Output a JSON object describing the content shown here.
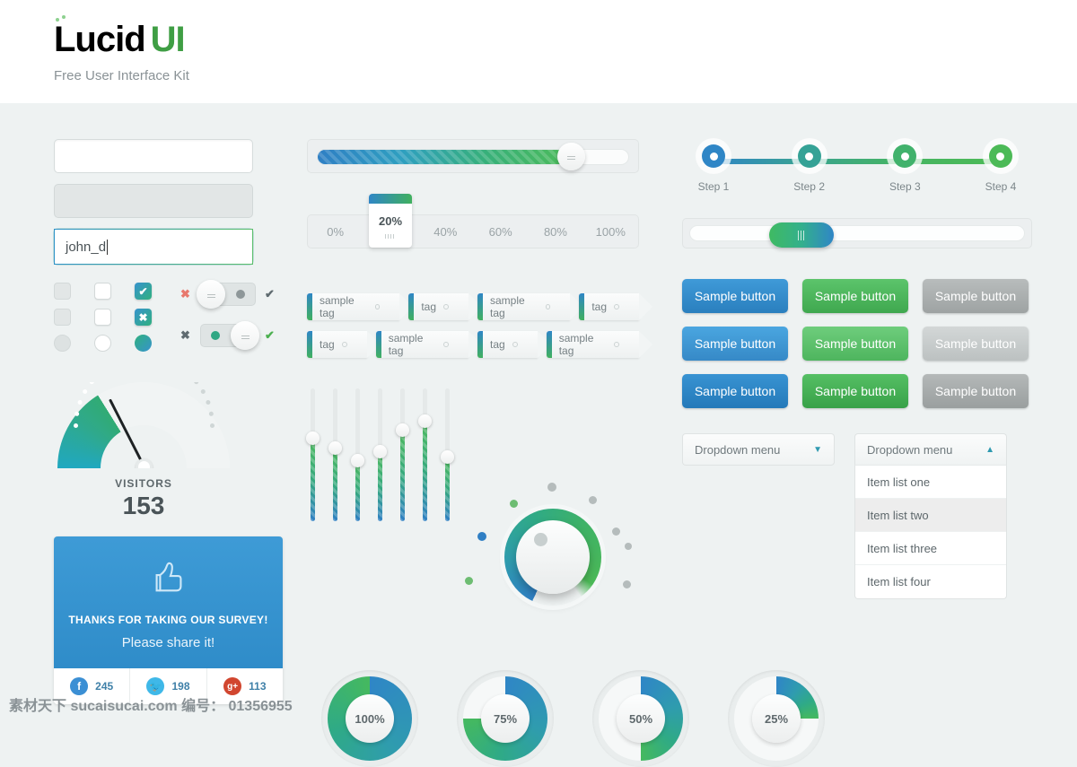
{
  "header": {
    "logo_lucid": "Lucid",
    "logo_ui": "UI",
    "tagline": "Free User Interface Kit"
  },
  "forms": {
    "input_empty_value": "",
    "input_empty_placeholder": "",
    "input_disabled_value": "",
    "input_focused_value": "john_d",
    "check_on": "✔",
    "check_off": "✖"
  },
  "toggles": [
    {
      "state": "off",
      "left_mark": "✖",
      "right_mark": "✔"
    },
    {
      "state": "on",
      "left_mark": "✖",
      "right_mark": "✔"
    }
  ],
  "gauge": {
    "label": "VISITORS",
    "value": "153",
    "percent": 35
  },
  "survey": {
    "headline": "THANKS FOR TAKING OUR SURVEY!",
    "subline": "Please share it!",
    "social": [
      {
        "name": "facebook",
        "glyph": "f",
        "color": "#3b8fd4",
        "count": "245"
      },
      {
        "name": "twitter",
        "glyph": "ᵛ",
        "color": "#3fb8e8",
        "count": "198"
      },
      {
        "name": "googleplus",
        "glyph": "g+",
        "color": "#d1462f",
        "count": "113"
      }
    ]
  },
  "slider": {
    "value_percent": 81
  },
  "percent_bar": {
    "options": [
      "0%",
      "20%",
      "40%",
      "60%",
      "80%",
      "100%"
    ],
    "selected": "20%"
  },
  "tags": {
    "row1": [
      "sample tag",
      "tag",
      "sample tag",
      "tag"
    ],
    "row2": [
      "tag",
      "sample tag",
      "tag",
      "sample tag"
    ]
  },
  "equalizer": {
    "values": [
      62,
      55,
      45,
      52,
      68,
      75,
      48
    ]
  },
  "knob": {
    "value_percent": 88
  },
  "circles": [
    {
      "label": "100%",
      "value": 100
    },
    {
      "label": "75%",
      "value": 75
    },
    {
      "label": "50%",
      "value": 50
    },
    {
      "label": "25%",
      "value": 25
    }
  ],
  "steps": [
    {
      "label": "Step 1",
      "color": "#2f86c6"
    },
    {
      "label": "Step 2",
      "color": "#35a296"
    },
    {
      "label": "Step 3",
      "color": "#41b26c"
    },
    {
      "label": "Step 4",
      "color": "#4cba57"
    }
  ],
  "scrollbar": {
    "value_percent": 30
  },
  "buttons": {
    "label": "Sample button",
    "rows": [
      [
        "blue",
        "green",
        "gray"
      ],
      [
        "blue l",
        "green l",
        "gray l"
      ],
      [
        "blue d",
        "green d",
        "gray d"
      ]
    ]
  },
  "dropdowns": {
    "closed": {
      "label": "Dropdown menu",
      "chevron": "▼"
    },
    "open": {
      "label": "Dropdown menu",
      "chevron": "▲",
      "items": [
        "Item list one",
        "Item list two",
        "Item list three",
        "Item list four"
      ],
      "highlighted": "Item list two"
    }
  },
  "footer": {
    "watermark": "素材天下 sucaisucai.com 编号： 01356955"
  }
}
